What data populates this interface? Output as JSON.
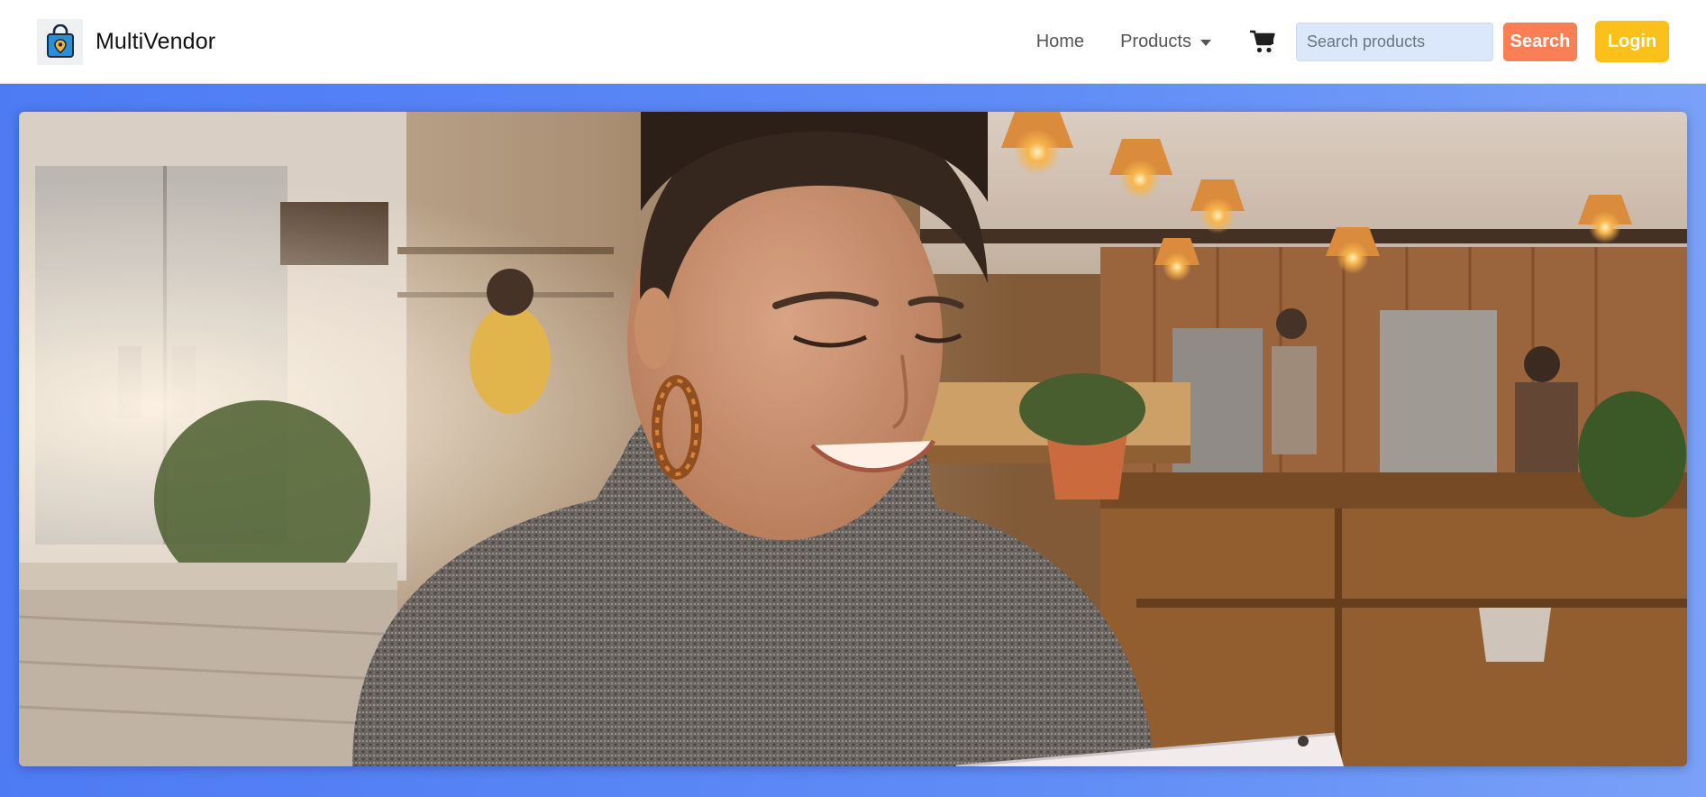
{
  "brand": {
    "name": "MultiVendor",
    "logo_icon": "shopping-bag-icon"
  },
  "nav": {
    "home_label": "Home",
    "products_label": "Products",
    "cart_icon": "cart-icon"
  },
  "search": {
    "placeholder": "Search products",
    "value": "",
    "button_label": "Search"
  },
  "login": {
    "label": "Login"
  },
  "colors": {
    "search_button": "#fb7f55",
    "login_button": "#fbc11a",
    "search_input_bg": "#dbe8fb",
    "hero_background": "#5b88f5"
  },
  "hero": {
    "media_type": "video-still",
    "subject": "young woman in grey turtleneck sweater smiling at a laptop in a cafe with pendant lights"
  }
}
